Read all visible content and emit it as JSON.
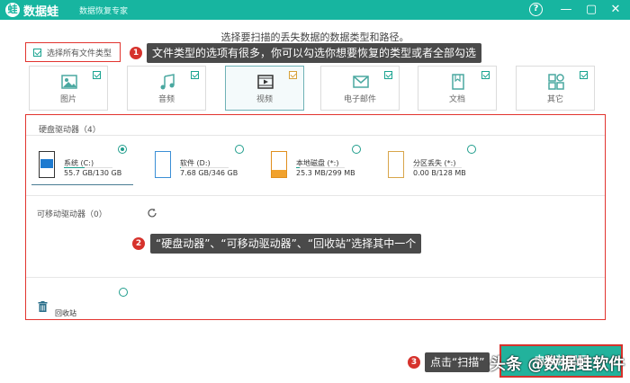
{
  "titlebar": {
    "logo": "蛙",
    "app_name": "数据蛙",
    "app_subtitle": "数据恢复专家",
    "help": "?",
    "minimize": "—",
    "maximize": "▢",
    "close": "✕"
  },
  "subtitle": "选择要扫描的丢失数据的数据类型和路径。",
  "select_all_label": "选择所有文件类型",
  "callouts": [
    {
      "num": "1",
      "text": "文件类型的选项有很多，你可以勾选你想要恢复的类型或者全部勾选"
    },
    {
      "num": "2",
      "text": "“硬盘动器”、“可移动驱动器”、“回收站”选择其中一个"
    },
    {
      "num": "3",
      "text": "点击“扫描”"
    }
  ],
  "file_types": [
    {
      "label": "图片",
      "icon": "image-icon",
      "selected": false
    },
    {
      "label": "音频",
      "icon": "music-icon",
      "selected": false
    },
    {
      "label": "视频",
      "icon": "video-icon",
      "selected": true
    },
    {
      "label": "电子邮件",
      "icon": "email-icon",
      "selected": false
    },
    {
      "label": "文档",
      "icon": "document-icon",
      "selected": false
    },
    {
      "label": "其它",
      "icon": "other-icon",
      "selected": false
    }
  ],
  "hard_drive_title": "硬盘驱动器（4）",
  "drives": [
    {
      "name": "系统 (C:)",
      "size": "55.7 GB/130 GB",
      "usage": 0.43,
      "selected": true,
      "icon": "system-drive-icon"
    },
    {
      "name": "软件 (D:)",
      "size": "7.68 GB/346 GB",
      "usage": 0.02,
      "selected": false,
      "icon": "drive-icon"
    },
    {
      "name": "本地磁盘 (*:)",
      "size": "25.3 MB/299 MB",
      "usage": 0.08,
      "selected": false,
      "icon": "usb-drive-icon"
    },
    {
      "name": "分区丢失 (*:)",
      "size": "0.00  B/128 MB",
      "usage": 0.0,
      "selected": false,
      "icon": "partition-icon"
    }
  ],
  "removable_title": "可移动驱动器（0）",
  "recycle_label": "回收站",
  "scan_label": "电脑装配网",
  "watermark": "头条 @数据蛙软件",
  "colors": {
    "accent": "#17b5a0",
    "highlight": "#e2342f"
  }
}
